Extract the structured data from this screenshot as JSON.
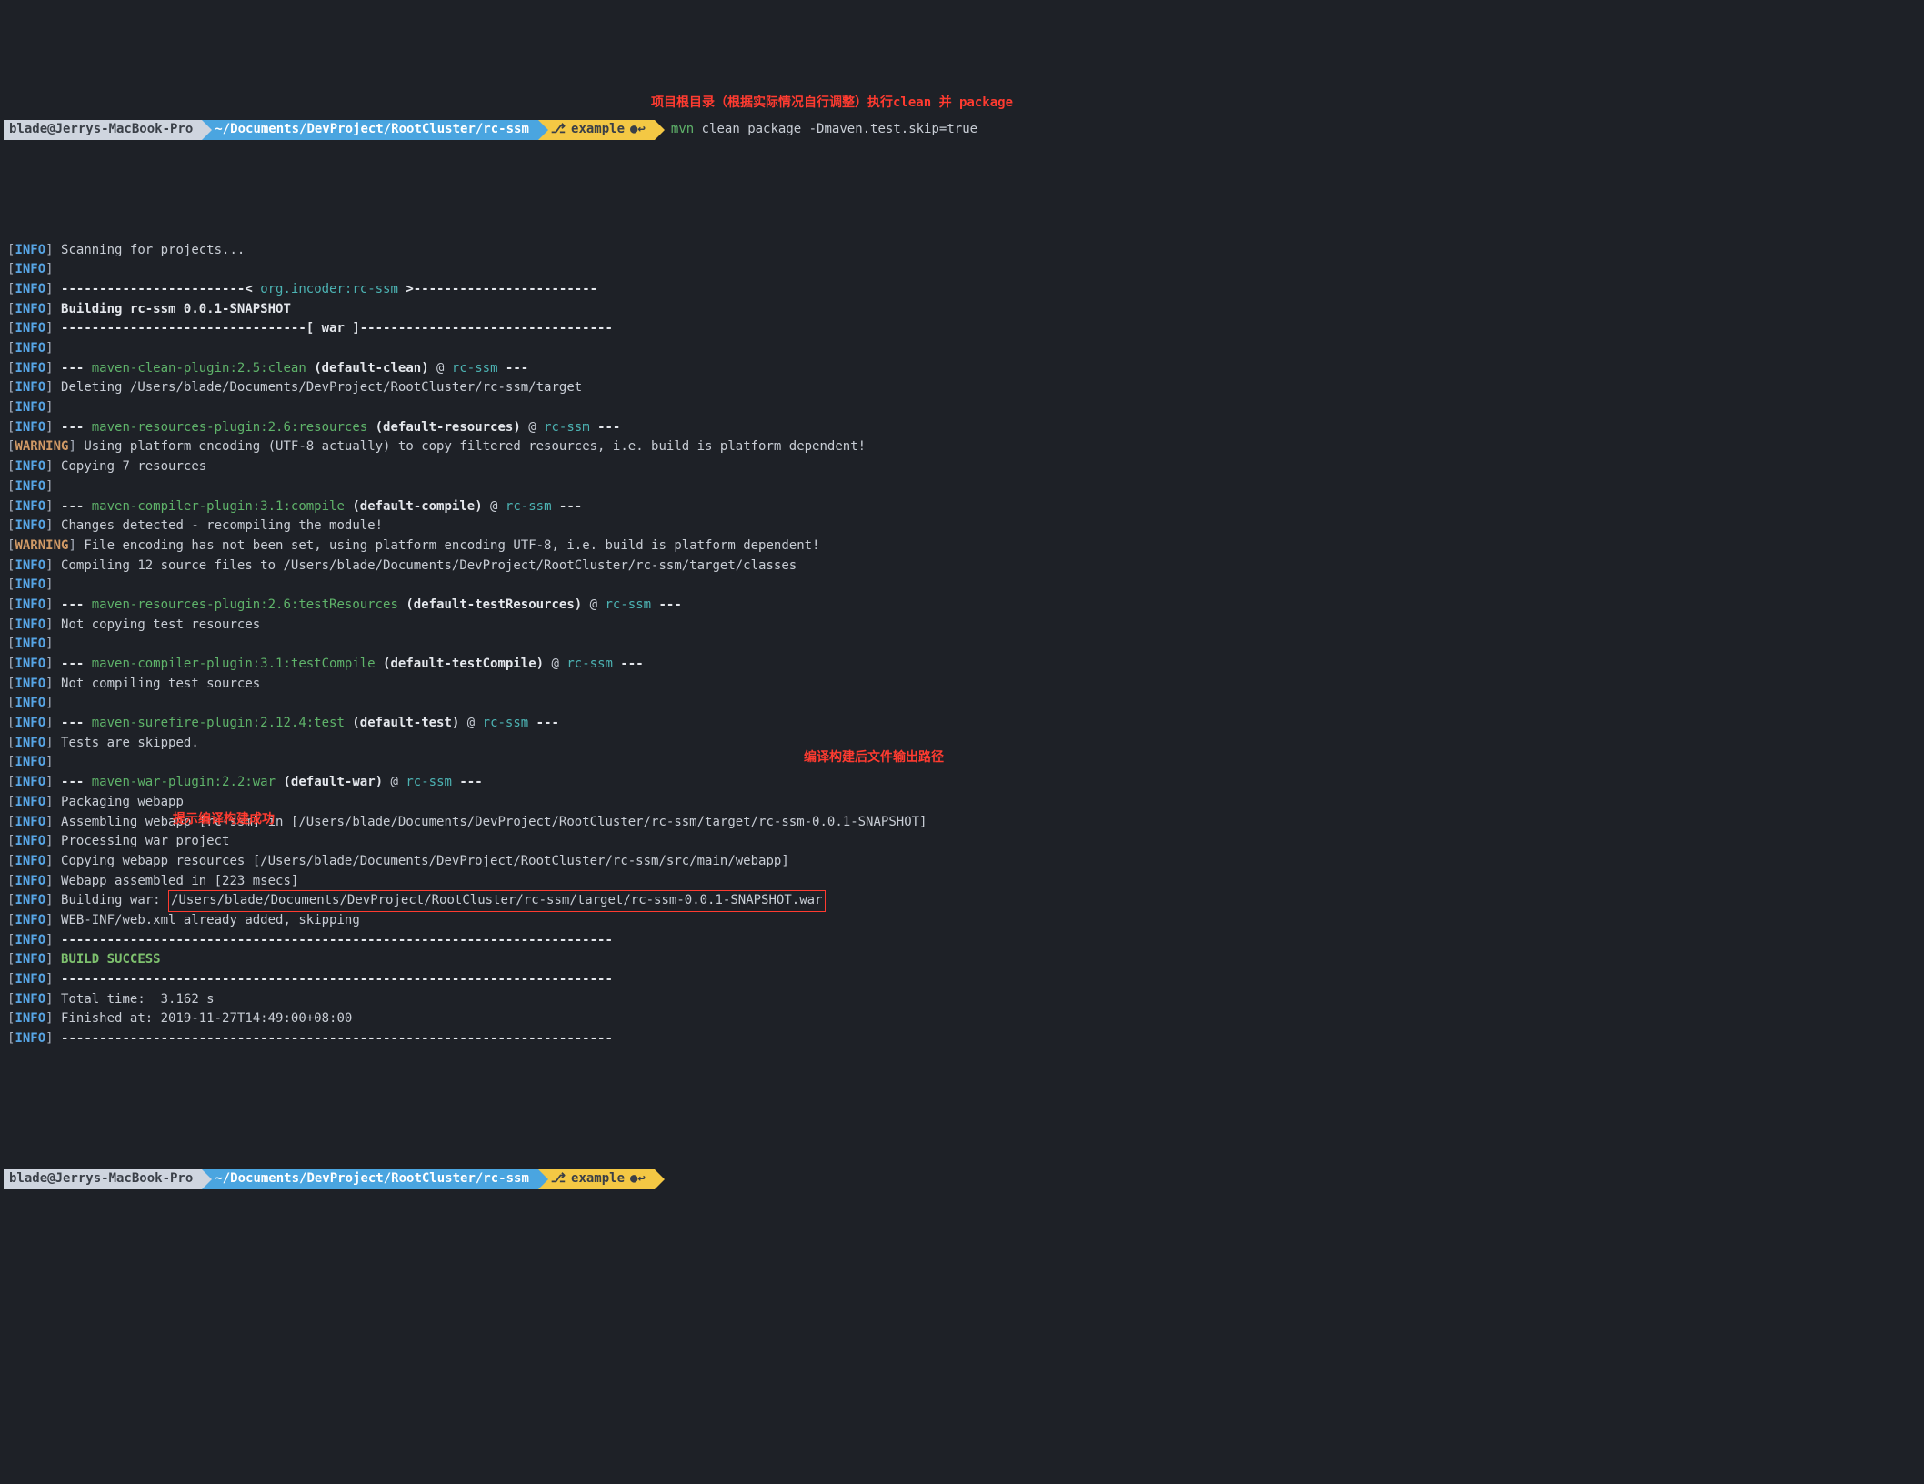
{
  "prompt": {
    "host": "blade@Jerrys-MacBook-Pro",
    "path": "~/Documents/DevProject/RootCluster/rc-ssm",
    "branch": "example",
    "command_name": "mvn",
    "command_args": " clean package -Dmaven.test.skip=true"
  },
  "annotations": {
    "a1": "项目根目录（根据实际情况自行调整）执行clean 并 package",
    "a2": "编译构建后文件输出路径",
    "a3": "提示编译构建成功"
  },
  "lines": [
    {
      "level": "INFO",
      "text": "Scanning for projects..."
    },
    {
      "level": "INFO",
      "text": ""
    },
    {
      "level": "INFO",
      "segs": [
        {
          "t": "------------------------< ",
          "c": "txt-bold"
        },
        {
          "t": "org.incoder:rc-ssm",
          "c": "art-cyan"
        },
        {
          "t": " >------------------------",
          "c": "txt-bold"
        }
      ]
    },
    {
      "level": "INFO",
      "segs": [
        {
          "t": "Building rc-ssm 0.0.1-SNAPSHOT",
          "c": "txt-bold"
        }
      ]
    },
    {
      "level": "INFO",
      "segs": [
        {
          "t": "--------------------------------[ war ]---------------------------------",
          "c": "txt-bold"
        }
      ]
    },
    {
      "level": "INFO",
      "text": ""
    },
    {
      "level": "INFO",
      "segs": [
        {
          "t": "--- ",
          "c": "txt-bold"
        },
        {
          "t": "maven-clean-plugin:2.5:clean",
          "c": "plugin"
        },
        {
          "t": " (default-clean)",
          "c": "txt-bold"
        },
        {
          "t": " @ ",
          "c": "txt"
        },
        {
          "t": "rc-ssm",
          "c": "art-cyan"
        },
        {
          "t": " ---",
          "c": "txt-bold"
        }
      ]
    },
    {
      "level": "INFO",
      "text": "Deleting /Users/blade/Documents/DevProject/RootCluster/rc-ssm/target"
    },
    {
      "level": "INFO",
      "text": ""
    },
    {
      "level": "INFO",
      "segs": [
        {
          "t": "--- ",
          "c": "txt-bold"
        },
        {
          "t": "maven-resources-plugin:2.6:resources",
          "c": "plugin"
        },
        {
          "t": " (default-resources)",
          "c": "txt-bold"
        },
        {
          "t": " @ ",
          "c": "txt"
        },
        {
          "t": "rc-ssm",
          "c": "art-cyan"
        },
        {
          "t": " ---",
          "c": "txt-bold"
        }
      ]
    },
    {
      "level": "WARNING",
      "text": "Using platform encoding (UTF-8 actually) to copy filtered resources, i.e. build is platform dependent!"
    },
    {
      "level": "INFO",
      "text": "Copying 7 resources"
    },
    {
      "level": "INFO",
      "text": ""
    },
    {
      "level": "INFO",
      "segs": [
        {
          "t": "--- ",
          "c": "txt-bold"
        },
        {
          "t": "maven-compiler-plugin:3.1:compile",
          "c": "plugin"
        },
        {
          "t": " (default-compile)",
          "c": "txt-bold"
        },
        {
          "t": " @ ",
          "c": "txt"
        },
        {
          "t": "rc-ssm",
          "c": "art-cyan"
        },
        {
          "t": " ---",
          "c": "txt-bold"
        }
      ]
    },
    {
      "level": "INFO",
      "text": "Changes detected - recompiling the module!"
    },
    {
      "level": "WARNING",
      "text": "File encoding has not been set, using platform encoding UTF-8, i.e. build is platform dependent!"
    },
    {
      "level": "INFO",
      "text": "Compiling 12 source files to /Users/blade/Documents/DevProject/RootCluster/rc-ssm/target/classes"
    },
    {
      "level": "INFO",
      "text": ""
    },
    {
      "level": "INFO",
      "segs": [
        {
          "t": "--- ",
          "c": "txt-bold"
        },
        {
          "t": "maven-resources-plugin:2.6:testResources",
          "c": "plugin"
        },
        {
          "t": " (default-testResources)",
          "c": "txt-bold"
        },
        {
          "t": " @ ",
          "c": "txt"
        },
        {
          "t": "rc-ssm",
          "c": "art-cyan"
        },
        {
          "t": " ---",
          "c": "txt-bold"
        }
      ]
    },
    {
      "level": "INFO",
      "text": "Not copying test resources"
    },
    {
      "level": "INFO",
      "text": ""
    },
    {
      "level": "INFO",
      "segs": [
        {
          "t": "--- ",
          "c": "txt-bold"
        },
        {
          "t": "maven-compiler-plugin:3.1:testCompile",
          "c": "plugin"
        },
        {
          "t": " (default-testCompile)",
          "c": "txt-bold"
        },
        {
          "t": " @ ",
          "c": "txt"
        },
        {
          "t": "rc-ssm",
          "c": "art-cyan"
        },
        {
          "t": " ---",
          "c": "txt-bold"
        }
      ]
    },
    {
      "level": "INFO",
      "text": "Not compiling test sources"
    },
    {
      "level": "INFO",
      "text": ""
    },
    {
      "level": "INFO",
      "segs": [
        {
          "t": "--- ",
          "c": "txt-bold"
        },
        {
          "t": "maven-surefire-plugin:2.12.4:test",
          "c": "plugin"
        },
        {
          "t": " (default-test)",
          "c": "txt-bold"
        },
        {
          "t": " @ ",
          "c": "txt"
        },
        {
          "t": "rc-ssm",
          "c": "art-cyan"
        },
        {
          "t": " ---",
          "c": "txt-bold"
        }
      ]
    },
    {
      "level": "INFO",
      "text": "Tests are skipped."
    },
    {
      "level": "INFO",
      "text": ""
    },
    {
      "level": "INFO",
      "segs": [
        {
          "t": "--- ",
          "c": "txt-bold"
        },
        {
          "t": "maven-war-plugin:2.2:war",
          "c": "plugin"
        },
        {
          "t": " (default-war)",
          "c": "txt-bold"
        },
        {
          "t": " @ ",
          "c": "txt"
        },
        {
          "t": "rc-ssm",
          "c": "art-cyan"
        },
        {
          "t": " ---",
          "c": "txt-bold"
        }
      ]
    },
    {
      "level": "INFO",
      "text": "Packaging webapp"
    },
    {
      "level": "INFO",
      "text": "Assembling webapp [rc-ssm] in [/Users/blade/Documents/DevProject/RootCluster/rc-ssm/target/rc-ssm-0.0.1-SNAPSHOT]"
    },
    {
      "level": "INFO",
      "text": "Processing war project"
    },
    {
      "level": "INFO",
      "text": "Copying webapp resources [/Users/blade/Documents/DevProject/RootCluster/rc-ssm/src/main/webapp]"
    },
    {
      "level": "INFO",
      "text": "Webapp assembled in [223 msecs]"
    },
    {
      "level": "INFO",
      "segs": [
        {
          "t": "Building war: ",
          "c": "txt"
        },
        {
          "t": "/Users/blade/Documents/DevProject/RootCluster/rc-ssm/target/rc-ssm-0.0.1-SNAPSHOT.war",
          "c": "hl-box"
        }
      ]
    },
    {
      "level": "INFO",
      "text": "WEB-INF/web.xml already added, skipping"
    },
    {
      "level": "INFO",
      "segs": [
        {
          "t": "------------------------------------------------------------------------",
          "c": "txt-bold"
        }
      ]
    },
    {
      "level": "INFO",
      "segs": [
        {
          "t": "BUILD SUCCESS",
          "c": "success"
        }
      ]
    },
    {
      "level": "INFO",
      "segs": [
        {
          "t": "------------------------------------------------------------------------",
          "c": "txt-bold"
        }
      ]
    },
    {
      "level": "INFO",
      "text": "Total time:  3.162 s"
    },
    {
      "level": "INFO",
      "text": "Finished at: 2019-11-27T14:49:00+08:00"
    },
    {
      "level": "INFO",
      "segs": [
        {
          "t": "------------------------------------------------------------------------",
          "c": "txt-bold"
        }
      ]
    }
  ]
}
